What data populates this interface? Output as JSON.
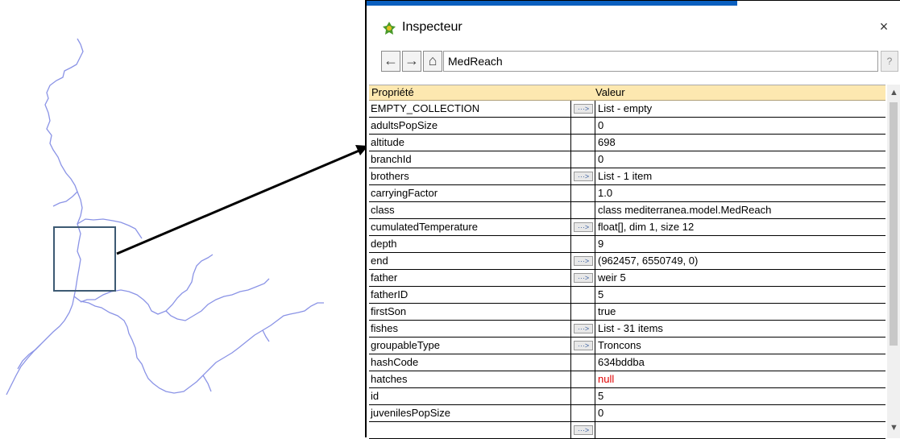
{
  "window": {
    "title": "Inspecteur",
    "close_glyph": "×",
    "title_icon": "inspector-icon"
  },
  "toolbar": {
    "back_glyph": "←",
    "forward_glyph": "→",
    "home_glyph": "⌂",
    "path_value": "MedReach",
    "help_glyph": "?"
  },
  "table": {
    "header_property": "Propriété",
    "header_value": "Valeur",
    "rows": [
      {
        "prop": "EMPTY_COLLECTION",
        "btn": true,
        "val": "List - empty"
      },
      {
        "prop": "adultsPopSize",
        "btn": false,
        "val": "0"
      },
      {
        "prop": "altitude",
        "btn": false,
        "val": "698"
      },
      {
        "prop": "branchId",
        "btn": false,
        "val": "0"
      },
      {
        "prop": "brothers",
        "btn": true,
        "val": "List - 1 item"
      },
      {
        "prop": "carryingFactor",
        "btn": false,
        "val": "1.0"
      },
      {
        "prop": "class",
        "btn": false,
        "val": "class mediterranea.model.MedReach"
      },
      {
        "prop": "cumulatedTemperature",
        "btn": true,
        "val": "float[], dim 1, size 12"
      },
      {
        "prop": "depth",
        "btn": false,
        "val": "9"
      },
      {
        "prop": "end",
        "btn": true,
        "val": "(962457, 6550749, 0)"
      },
      {
        "prop": "father",
        "btn": true,
        "val": "weir 5"
      },
      {
        "prop": "fatherID",
        "btn": false,
        "val": "5"
      },
      {
        "prop": "firstSon",
        "btn": false,
        "val": "true"
      },
      {
        "prop": "fishes",
        "btn": true,
        "val": "List - 31 items"
      },
      {
        "prop": "groupableType",
        "btn": true,
        "val": "Troncons"
      },
      {
        "prop": "hashCode",
        "btn": false,
        "val": "634bddba"
      },
      {
        "prop": "hatches",
        "btn": false,
        "val": "null",
        "color": "#e00000"
      },
      {
        "prop": "id",
        "btn": false,
        "val": "5"
      },
      {
        "prop": "juvenilesPopSize",
        "btn": false,
        "val": "0"
      },
      {
        "prop": "",
        "btn": true,
        "val": ""
      }
    ],
    "ellipsis_glyph": "···>"
  },
  "colors": {
    "river": "#8a93e6",
    "header_bg": "#fde8b0",
    "zoom_box": "#3d5a73",
    "null_value": "#e00000"
  }
}
